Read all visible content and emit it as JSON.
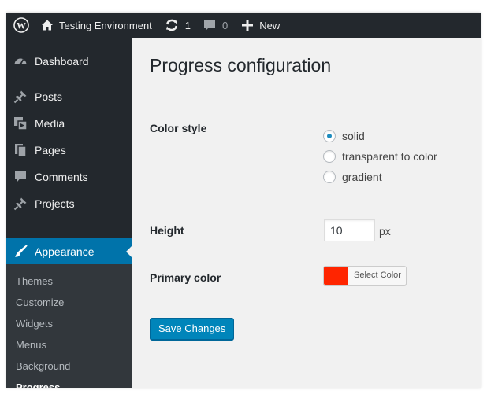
{
  "admin_bar": {
    "site_name": "Testing Environment",
    "updates_count": "1",
    "comments_count": "0",
    "new_label": "New",
    "icons": [
      "wordpress-logo-icon",
      "home-icon",
      "updates-icon",
      "comment-icon",
      "plus-icon"
    ]
  },
  "sidebar": {
    "items": [
      {
        "label": "Dashboard",
        "icon": "dashboard-icon"
      },
      {
        "label": "Posts",
        "icon": "pin-icon"
      },
      {
        "label": "Media",
        "icon": "media-icon"
      },
      {
        "label": "Pages",
        "icon": "pages-icon"
      },
      {
        "label": "Comments",
        "icon": "comment-icon"
      },
      {
        "label": "Projects",
        "icon": "pin-icon"
      },
      {
        "label": "Appearance",
        "icon": "brush-icon"
      }
    ],
    "submenu": [
      "Themes",
      "Customize",
      "Widgets",
      "Menus",
      "Background",
      "Progress"
    ],
    "active_submenu": "Progress"
  },
  "page": {
    "title": "Progress configuration",
    "color_style": {
      "label": "Color style",
      "options": [
        "solid",
        "transparent to color",
        "gradient"
      ],
      "selected": "solid"
    },
    "height": {
      "label": "Height",
      "value": "10",
      "unit": "px"
    },
    "primary_color": {
      "label": "Primary color",
      "value": "#ff2500",
      "button_label": "Select Color"
    },
    "save_label": "Save Changes"
  },
  "colors": {
    "admin_dark": "#23282d",
    "submenu_bg": "#32373c",
    "accent": "#0073aa",
    "button_blue": "#0085ba",
    "content_bg": "#f1f1f1"
  }
}
